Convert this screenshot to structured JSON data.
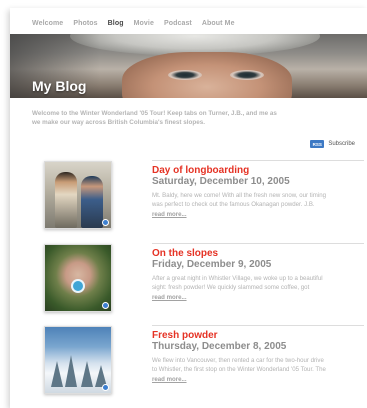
{
  "nav": {
    "items": [
      {
        "label": "Welcome"
      },
      {
        "label": "Photos"
      },
      {
        "label": "Blog",
        "active": true
      },
      {
        "label": "Movie"
      },
      {
        "label": "Podcast"
      },
      {
        "label": "About Me"
      }
    ]
  },
  "banner": {
    "title": "My Blog"
  },
  "intro": {
    "line1": "Welcome to the Winter Wonderland '05 Tour! Keep tabs on Turner, J.B., and me as",
    "line2": "we make our way across British Columbia's finest slopes."
  },
  "subscribe": {
    "rss_icon_text": "RSS",
    "label": "Subscribe"
  },
  "posts": [
    {
      "title": "Day of longboarding",
      "date": "Saturday, December 10, 2005",
      "excerpt_line1": "Mt. Baldy, here we come! With all the fresh new snow, our timing",
      "excerpt_line2": "was perfect to check out the famous Okanagan powder. J.B.",
      "more": "read more..."
    },
    {
      "title": "On the slopes",
      "date": "Friday, December 9, 2005",
      "excerpt_line1": "After a great night in Whistler Village, we woke up to a beautiful",
      "excerpt_line2": "sight: fresh powder! We quickly slammed some coffee, got",
      "more": "read more..."
    },
    {
      "title": "Fresh powder",
      "date": "Thursday, December 8, 2005",
      "excerpt_line1": "We flew into Vancouver, then rented a car for the two-hour drive",
      "excerpt_line2": "to Whistler, the first stop on the Winter Wonderland '05 Tour. The",
      "more": "read more..."
    }
  ],
  "colors": {
    "accent": "#e53224",
    "rss": "#3d79c4"
  }
}
